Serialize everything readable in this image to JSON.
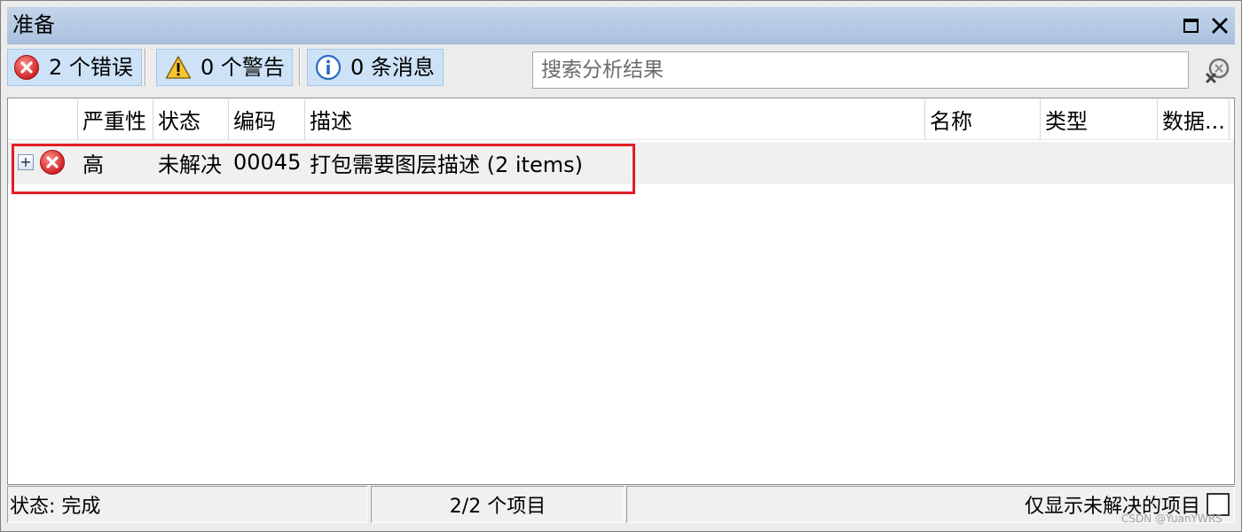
{
  "window": {
    "title": "准备",
    "maximize_icon": "maximize-icon",
    "close_icon": "close-icon"
  },
  "toolbar": {
    "filters": [
      {
        "icon": "error-icon",
        "label": "2 个错误",
        "active": true
      },
      {
        "icon": "warning-icon",
        "label": "0 个警告",
        "active": true
      },
      {
        "icon": "info-icon",
        "label": "0 条消息",
        "active": true
      }
    ],
    "search": {
      "placeholder": "搜索分析结果",
      "value": "",
      "button_icon": "clear-search-icon"
    }
  },
  "table": {
    "columns": [
      "严重性",
      "状态",
      "编码",
      "描述",
      "名称",
      "类型",
      "数据..."
    ],
    "rows": [
      {
        "expander": "+",
        "icon": "error-icon",
        "severity": "高",
        "status": "未解决",
        "code": "00045",
        "description": "打包需要图层描述 (2 items)"
      }
    ]
  },
  "status_bar": {
    "state": "状态: 完成",
    "item_count": "2/2 个项目",
    "unresolved_only_label": "仅显示未解决的项目",
    "unresolved_only_checked": false
  },
  "watermark": "CSDN @YuanYWRS",
  "colors": {
    "titlebar": "#a9c1de",
    "filter_button": "#cde2f6",
    "highlight": "#e31e24",
    "error": "#c8151b",
    "warning": "#f6c531",
    "info": "#2c6cc1"
  }
}
